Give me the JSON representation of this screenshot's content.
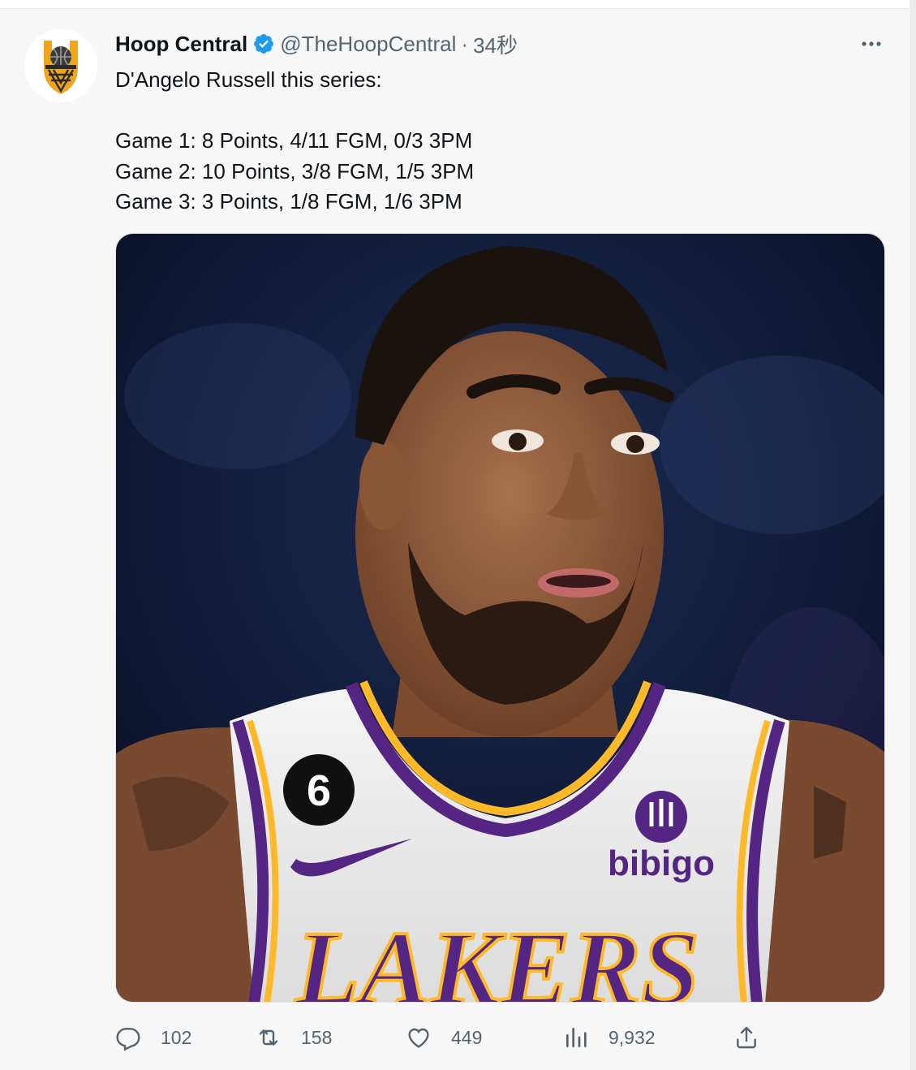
{
  "tweet": {
    "author_name": "Hoop Central",
    "handle": "@TheHoopCentral",
    "separator": "·",
    "time": "34秒",
    "text_lines": [
      "D'Angelo Russell this series:",
      "",
      "Game 1: 8 Points, 4/11 FGM, 0/3 3PM",
      "Game 2: 10 Points, 3/8 FGM, 1/5 3PM",
      "Game 3: 3 Points, 1/8 FGM, 1/6 3PM"
    ],
    "media": {
      "jersey_number": "6",
      "sponsor": "bibigo",
      "team": "LAKERS"
    },
    "stats": {
      "replies": "102",
      "retweets": "158",
      "likes": "449",
      "views": "9,932"
    }
  },
  "icons": {
    "verified": "verified-badge-icon",
    "more": "more-options-icon",
    "reply": "reply-icon",
    "retweet": "retweet-icon",
    "like": "heart-icon",
    "views": "views-icon",
    "share": "share-icon"
  },
  "colors": {
    "verified_blue": "#1d9bf0",
    "secondary_text": "#536471",
    "lakers_purple": "#552583",
    "lakers_gold": "#fdb927",
    "logo_orange": "#f0a418"
  }
}
